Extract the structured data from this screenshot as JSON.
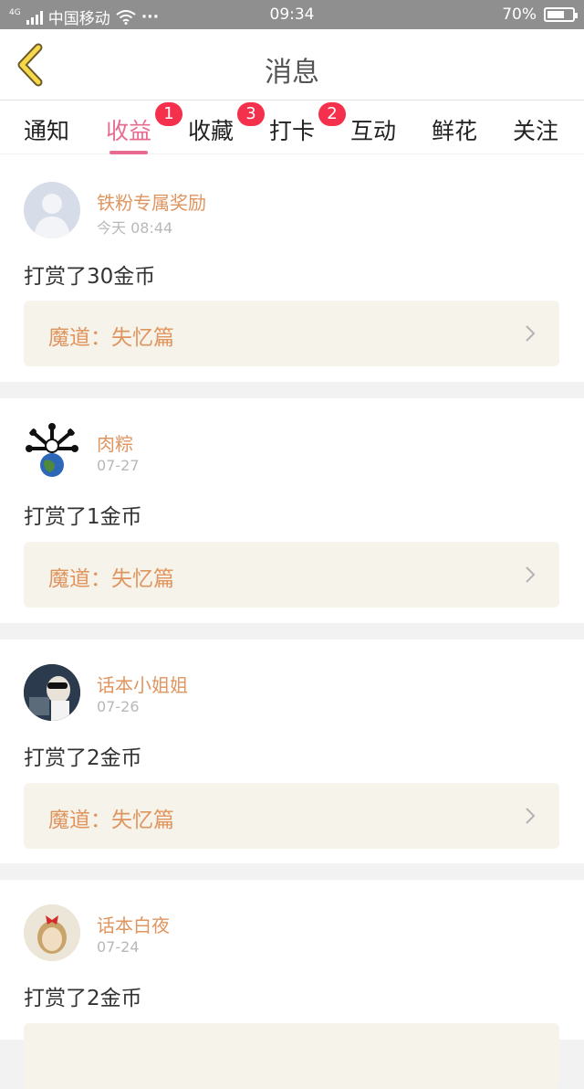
{
  "status_bar": {
    "network_badge": "4G",
    "carrier": "中国移动",
    "wifi_icon": "wifi-icon",
    "more_dots": "···",
    "time": "09:34",
    "battery_percent": "70%",
    "battery_level": 0.7
  },
  "header": {
    "back_icon": "back-chevron-icon",
    "title": "消息"
  },
  "tabs": [
    {
      "label": "通知",
      "badge": ""
    },
    {
      "label": "收益",
      "badge": "1",
      "active": true
    },
    {
      "label": "收藏",
      "badge": "3"
    },
    {
      "label": "打卡",
      "badge": "2"
    },
    {
      "label": "互动",
      "badge": ""
    },
    {
      "label": "鲜花",
      "badge": ""
    },
    {
      "label": "关注",
      "badge": ""
    }
  ],
  "colors": {
    "accent_pink": "#e86b8f",
    "name_orange": "#e0955f",
    "badge_red": "#f5304c",
    "work_bg": "#f5f3ea"
  },
  "messages": [
    {
      "name": "铁粉专属奖励",
      "time": "今天 08:44",
      "text": "打赏了30金币",
      "work": "魔道：失忆篇",
      "avatar": "default-avatar-icon"
    },
    {
      "name": "肉粽",
      "time": "07-27",
      "text": "打赏了1金币",
      "work": "魔道：失忆篇",
      "avatar": "globe-bones-avatar"
    },
    {
      "name": "话本小姐姐",
      "time": "07-26",
      "text": "打赏了2金币",
      "work": "魔道：失忆篇",
      "avatar": "photo-avatar"
    },
    {
      "name": "话本白夜",
      "time": "07-24",
      "text": "打赏了2金币",
      "work": "",
      "avatar": "photo-avatar-red-bow"
    }
  ]
}
